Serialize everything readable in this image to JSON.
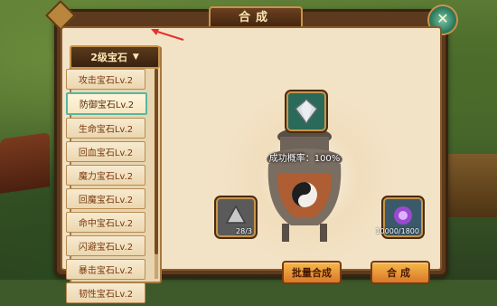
{
  "window": {
    "title": "合成",
    "close_glyph": "✕"
  },
  "dropdown": {
    "label": "2级宝石",
    "icon": "triangle-down-icon"
  },
  "gem_list": [
    {
      "label": "攻击宝石Lv.2",
      "selected": false
    },
    {
      "label": "防御宝石Lv.2",
      "selected": true
    },
    {
      "label": "生命宝石Lv.2",
      "selected": false
    },
    {
      "label": "回血宝石Lv.2",
      "selected": false
    },
    {
      "label": "魔力宝石Lv.2",
      "selected": false
    },
    {
      "label": "回魔宝石Lv.2",
      "selected": false
    },
    {
      "label": "命中宝石Lv.2",
      "selected": false
    },
    {
      "label": "闪避宝石Lv.2",
      "selected": false
    },
    {
      "label": "暴击宝石Lv.2",
      "selected": false
    },
    {
      "label": "韧性宝石Lv.2",
      "selected": false
    }
  ],
  "synthesis": {
    "success_rate_text": "成功概率：100%",
    "material_count": "28/3",
    "currency_count": "10000/1800"
  },
  "buttons": {
    "batch_label": "批量合成",
    "synth_label": "合成"
  },
  "colors": {
    "accent": "#c8944a",
    "selected_border": "#56b8a0",
    "annotation": "#e53030"
  }
}
